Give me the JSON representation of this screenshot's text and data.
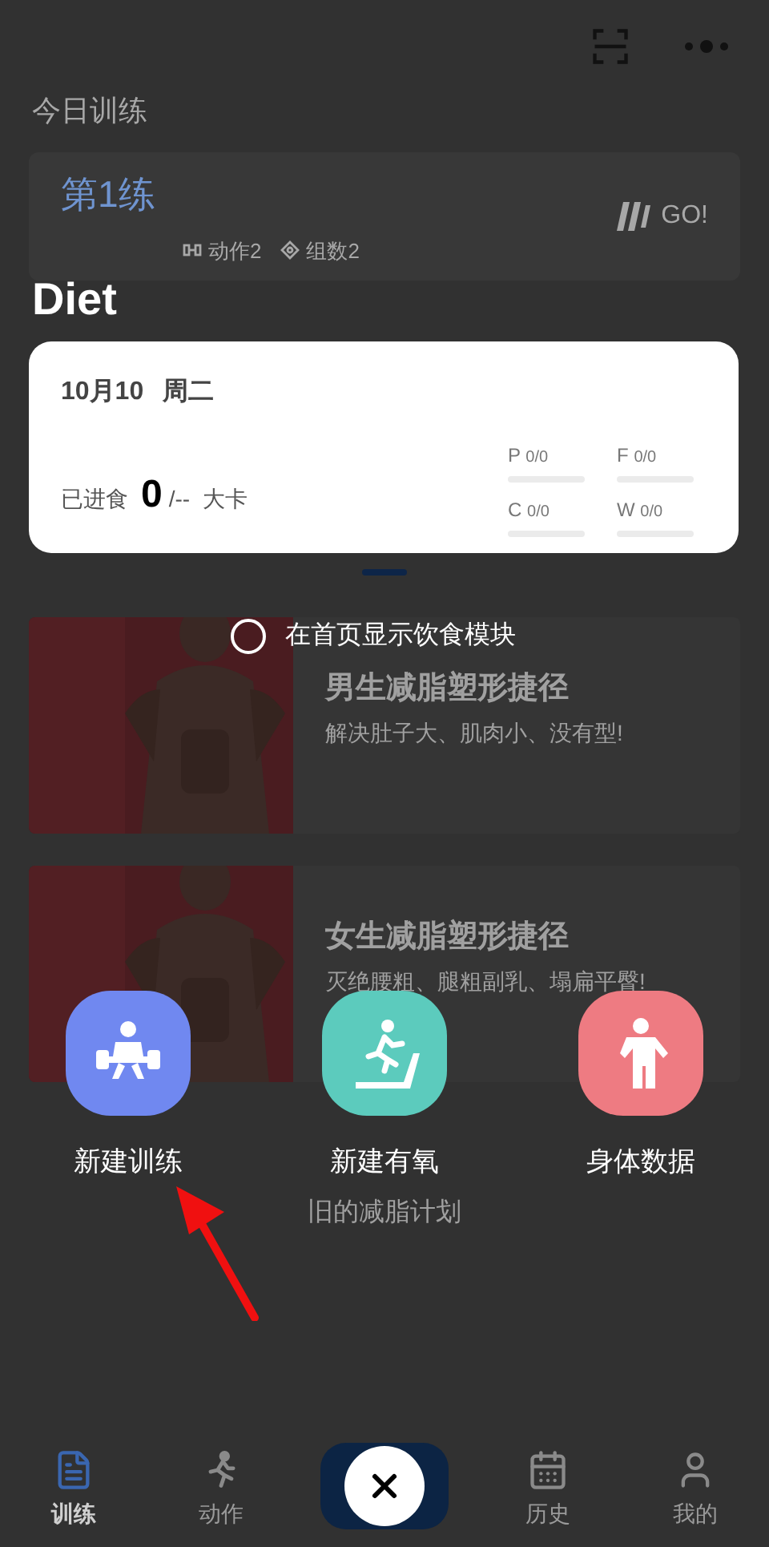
{
  "today": {
    "heading": "今日训练",
    "workout": {
      "title": "第1练",
      "stats": [
        {
          "kind": "moves",
          "label": "动作",
          "value": "2"
        },
        {
          "kind": "sets",
          "label": "组数",
          "value": "2"
        }
      ],
      "go": "GO!"
    }
  },
  "articles": [
    {
      "title": "男生减脂塑形捷径",
      "subtitle": "解决肚子大、肌肉小、没有型!",
      "kind": "picture"
    },
    {
      "title": "女生减脂塑形捷径",
      "subtitle": "灭绝腰粗、腿粗副乳、塌扁平臀!",
      "kind": "picture"
    }
  ],
  "old_plan": "旧的减脂计划",
  "tab_bar": [
    {
      "label": "训练",
      "kind": "doc",
      "selected": true
    },
    {
      "label": "动作",
      "kind": "run",
      "selected": false
    },
    {
      "label": "历史",
      "kind": "calendar",
      "selected": false
    },
    {
      "label": "我的",
      "kind": "user",
      "selected": false
    }
  ],
  "overlay": {
    "title": "Diet",
    "diet_card": {
      "date": "10月10",
      "weekday": "周二",
      "intake_label": "已进食",
      "intake_value": "0",
      "intake_target": "/--",
      "unit": "大卡",
      "macros": [
        {
          "letter": "P",
          "value": "0",
          "target": "/0"
        },
        {
          "letter": "F",
          "value": "0",
          "target": "/0"
        },
        {
          "letter": "C",
          "value": "0",
          "target": "/0"
        },
        {
          "letter": "W",
          "value": "0",
          "target": "/0"
        }
      ]
    },
    "show_on_home": {
      "label": "在首页显示饮食模块",
      "checked": false
    },
    "actions": [
      {
        "kind": "lift",
        "label": "新建训练",
        "color": "#7088f0"
      },
      {
        "kind": "treadmill",
        "label": "新建有氧",
        "color": "#5ccbbd"
      },
      {
        "kind": "body",
        "label": "身体数据",
        "color": "#ee7b82"
      }
    ]
  }
}
